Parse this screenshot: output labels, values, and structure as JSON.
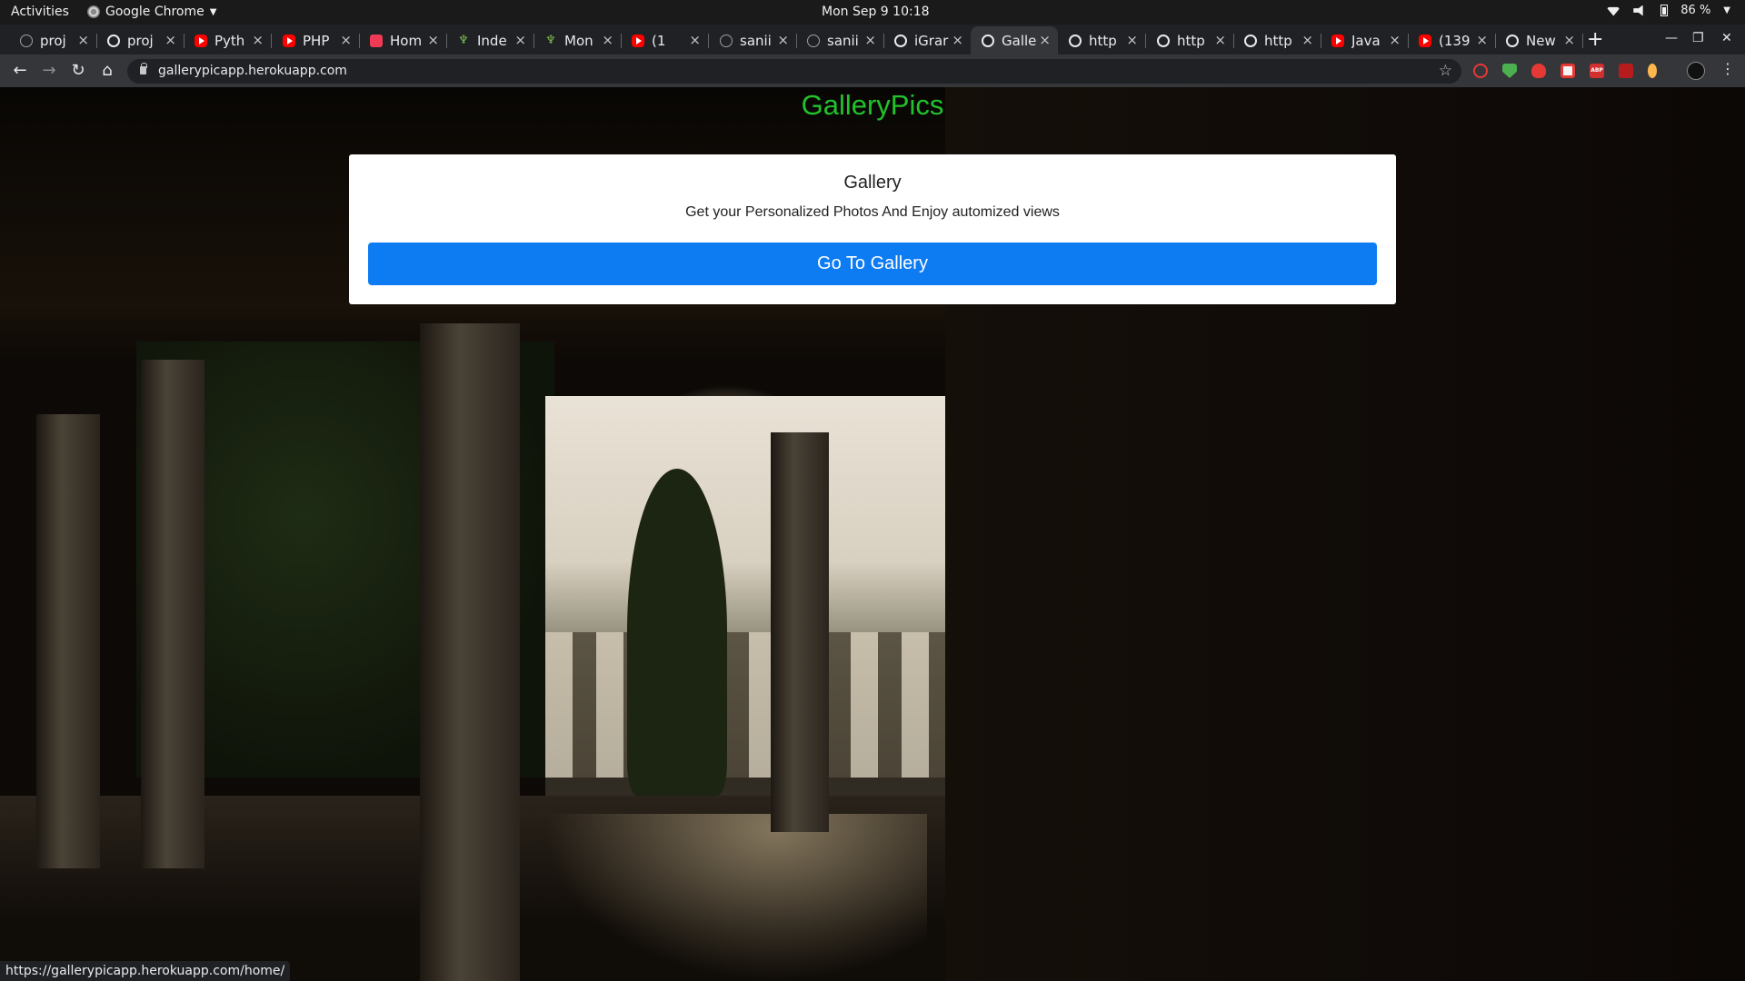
{
  "system_bar": {
    "activities": "Activities",
    "app_name": "Google Chrome",
    "clock": "Mon Sep 9  10:18",
    "battery": "86 %"
  },
  "tabs": [
    {
      "label": "proj",
      "icon": "github-icon",
      "active": false
    },
    {
      "label": "proj",
      "icon": "globe-icon",
      "active": false
    },
    {
      "label": "Pyth",
      "icon": "youtube-icon",
      "active": false
    },
    {
      "label": "PHP",
      "icon": "youtube-icon",
      "active": false
    },
    {
      "label": "Hom",
      "icon": "heroku-icon",
      "active": false
    },
    {
      "label": "Inde",
      "icon": "palm-icon",
      "active": false
    },
    {
      "label": "Mon",
      "icon": "palm-icon",
      "active": false
    },
    {
      "label": "(1",
      "icon": "youtube-icon",
      "active": false
    },
    {
      "label": "sanii",
      "icon": "github-icon",
      "active": false
    },
    {
      "label": "sanii",
      "icon": "github-icon",
      "active": false
    },
    {
      "label": "iGrar",
      "icon": "globe-icon",
      "active": false
    },
    {
      "label": "Galle",
      "icon": "globe-icon",
      "active": true
    },
    {
      "label": "http",
      "icon": "globe-icon",
      "active": false
    },
    {
      "label": "http",
      "icon": "globe-icon",
      "active": false
    },
    {
      "label": "http",
      "icon": "globe-icon",
      "active": false
    },
    {
      "label": "Java",
      "icon": "youtube-icon",
      "active": false
    },
    {
      "label": "(139",
      "icon": "youtube-icon",
      "active": false
    },
    {
      "label": "New",
      "icon": "globe-icon",
      "active": false
    }
  ],
  "tab_close_glyph": "×",
  "new_tab_glyph": "+",
  "address_bar": {
    "url": "gallerypicapp.herokuapp.com"
  },
  "page": {
    "site_title": "GalleryPics",
    "site_title_color": "#22c22c",
    "card": {
      "title": "Gallery",
      "text": "Get your Personalized Photos And Enjoy automized views",
      "button_label": "Go To Gallery",
      "button_color": "#0d7bf2"
    }
  },
  "status_bar": {
    "link": "https://gallerypicapp.herokuapp.com/home/"
  }
}
